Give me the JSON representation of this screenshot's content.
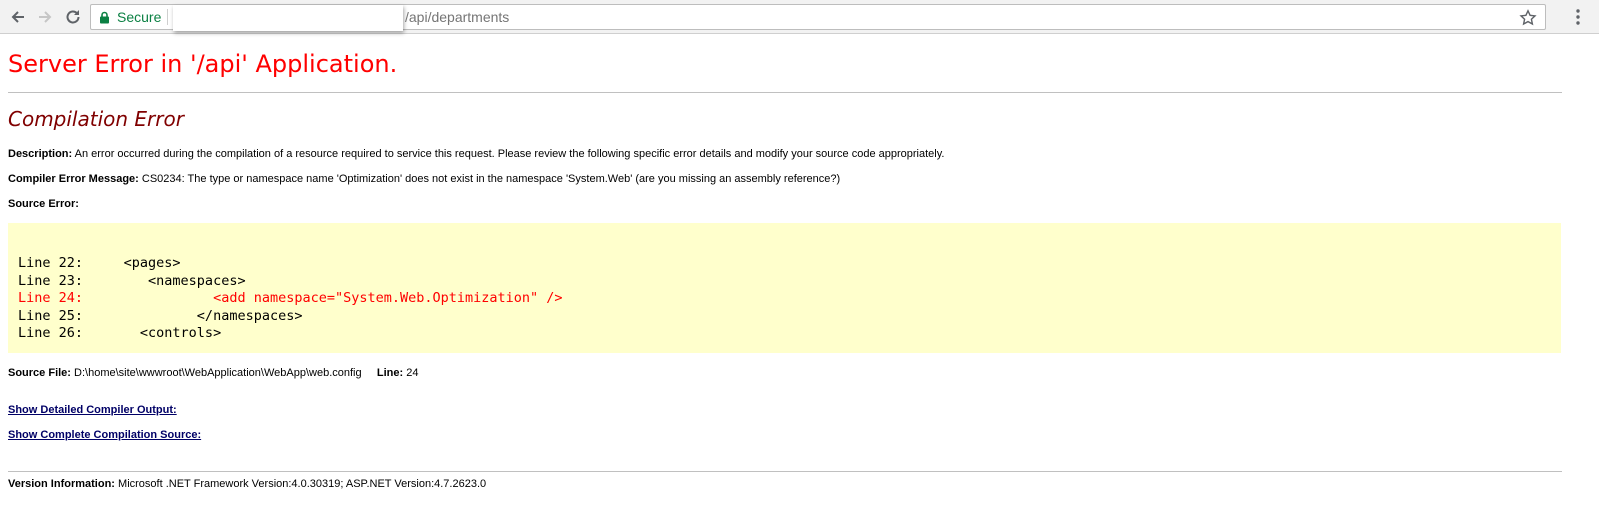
{
  "browser": {
    "secure_label": "Secure",
    "url_path": "/api/departments"
  },
  "page": {
    "title": "Server Error in '/api' Application.",
    "subtitle": "Compilation Error",
    "description_label": "Description:",
    "description_text": "An error occurred during the compilation of a resource required to service this request. Please review the following specific error details and modify your source code appropriately.",
    "compiler_msg_label": "Compiler Error Message:",
    "compiler_msg_text": "CS0234: The type or namespace name 'Optimization' does not exist in the namespace 'System.Web' (are you missing an assembly reference?)",
    "source_error_label": "Source Error:",
    "code_lines": [
      {
        "text": "Line 22:     <pages>",
        "is_error": false
      },
      {
        "text": "Line 23:        <namespaces>",
        "is_error": false
      },
      {
        "text": "Line 24:                <add namespace=\"System.Web.Optimization\" />",
        "is_error": true
      },
      {
        "text": "Line 25:              </namespaces>",
        "is_error": false
      },
      {
        "text": "Line 26:       <controls>",
        "is_error": false
      }
    ],
    "source_file_label": "Source File:",
    "source_file_path": "D:\\home\\site\\wwwroot\\WebApplication\\WebApp\\web.config",
    "line_label": "Line:",
    "line_number": "24",
    "link_detailed": "Show Detailed Compiler Output:",
    "link_complete": "Show Complete Compilation Source:",
    "version_label": "Version Information:",
    "version_text": "Microsoft .NET Framework Version:4.0.30319; ASP.NET Version:4.7.2623.0"
  },
  "colors": {
    "title": "#ff0000",
    "subtitle": "#800000",
    "code_background": "#ffffcc",
    "secure": "#0b8043",
    "link": "#000066"
  }
}
